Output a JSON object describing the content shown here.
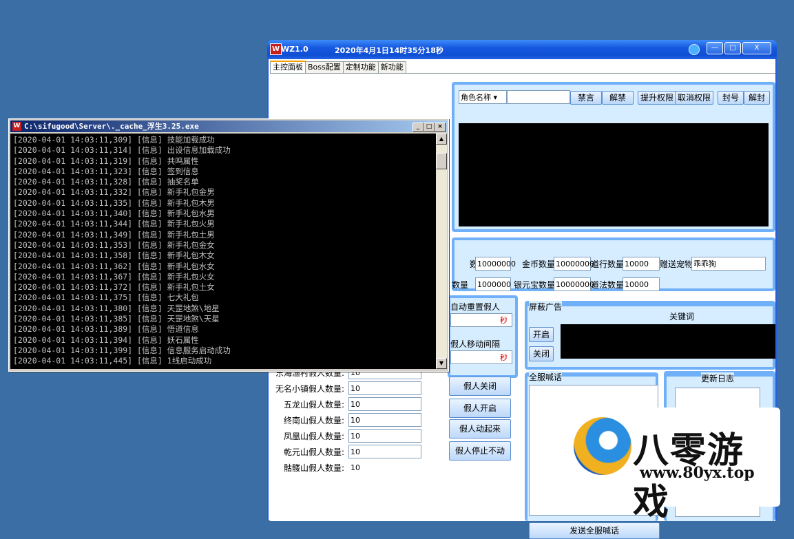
{
  "main_window": {
    "title": "WZ1.0",
    "datetime": "2020年4月1日14时35分18秒",
    "min_btn": "—",
    "max_btn": "□",
    "close_btn": "X",
    "tabs": [
      "主控面板",
      "Boss配置",
      "定制功能",
      "新功能"
    ],
    "role_search": {
      "dropdown": "角色名称 ▾",
      "input": "",
      "buttons": [
        "禁言",
        "解禁",
        "提升权限",
        "取消权限",
        "封号",
        "解封"
      ]
    },
    "values_row1": [
      {
        "label": "数",
        "value": "10000000"
      },
      {
        "label": "金币数量",
        "value": "10000000"
      },
      {
        "label": "道行数量",
        "value": "10000"
      },
      {
        "label": "赠送宠物",
        "value": "乖乖狗"
      }
    ],
    "values_row2": [
      {
        "label": "数量",
        "value": "1000000"
      },
      {
        "label": "银元宝数量",
        "value": "10000000"
      },
      {
        "label": "道法数量",
        "value": "10000"
      }
    ],
    "auto_refresh": {
      "label": "自动重置假人",
      "unit": "秒"
    },
    "move_interval": {
      "label": "假人移动间隔",
      "unit": "秒"
    },
    "fake_counts": [
      {
        "label": "东海渔村假人数量:",
        "value": "10"
      },
      {
        "label": "无名小镇假人数量:",
        "value": "10"
      },
      {
        "label": "五龙山假人数量:",
        "value": "10"
      },
      {
        "label": "终南山假人数量:",
        "value": "10"
      },
      {
        "label": "凤凰山假人数量:",
        "value": "10"
      },
      {
        "label": "乾元山假人数量:",
        "value": "10"
      },
      {
        "label": "骷髅山假人数量:",
        "value": "10"
      }
    ],
    "fake_buttons": [
      "假人关闭",
      "假人开启",
      "假人动起来",
      "假人停止不动"
    ],
    "block_ads": {
      "title": "屏蔽广告",
      "keywords": "关键词",
      "open": "开启",
      "close": "关闭"
    },
    "shout": {
      "title": "全服喊话",
      "send": "发送全服喊话"
    },
    "update_log": {
      "title": "更新日志"
    }
  },
  "console": {
    "title": "C:\\sifugood\\Server\\._cache_浮生3.25.exe",
    "logs": [
      "[2020-04-01 14:03:11,309] [信息] 技能加载成功",
      "[2020-04-01 14:03:11,314] [信息] 出设信息加载成功",
      "[2020-04-01 14:03:11,319] [信息] 共鸣属性",
      "[2020-04-01 14:03:11,323] [信息] 签到信息",
      "[2020-04-01 14:03:11,328] [信息] 抽奖名单",
      "[2020-04-01 14:03:11,332] [信息] 新手礼包金男",
      "[2020-04-01 14:03:11,335] [信息] 新手礼包木男",
      "[2020-04-01 14:03:11,340] [信息] 新手礼包水男",
      "[2020-04-01 14:03:11,344] [信息] 新手礼包火男",
      "[2020-04-01 14:03:11,349] [信息] 新手礼包土男",
      "[2020-04-01 14:03:11,353] [信息] 新手礼包金女",
      "[2020-04-01 14:03:11,358] [信息] 新手礼包木女",
      "[2020-04-01 14:03:11,362] [信息] 新手礼包水女",
      "[2020-04-01 14:03:11,367] [信息] 新手礼包火女",
      "[2020-04-01 14:03:11,372] [信息] 新手礼包土女",
      "[2020-04-01 14:03:11,375] [信息] 七大礼包",
      "[2020-04-01 14:03:11,380] [信息] 天罡地煞\\地星",
      "[2020-04-01 14:03:11,385] [信息] 天罡地煞\\天星",
      "[2020-04-01 14:03:11,389] [信息] 悟道信息",
      "[2020-04-01 14:03:11,394] [信息] 妖石属性",
      "[2020-04-01 14:03:11,399] [信息] 信息服务启动成功",
      "[2020-04-01 14:03:11,445] [信息] 1线启动成功"
    ]
  },
  "watermark": {
    "name": "八零游戏",
    "url": "www.80yx.top"
  }
}
